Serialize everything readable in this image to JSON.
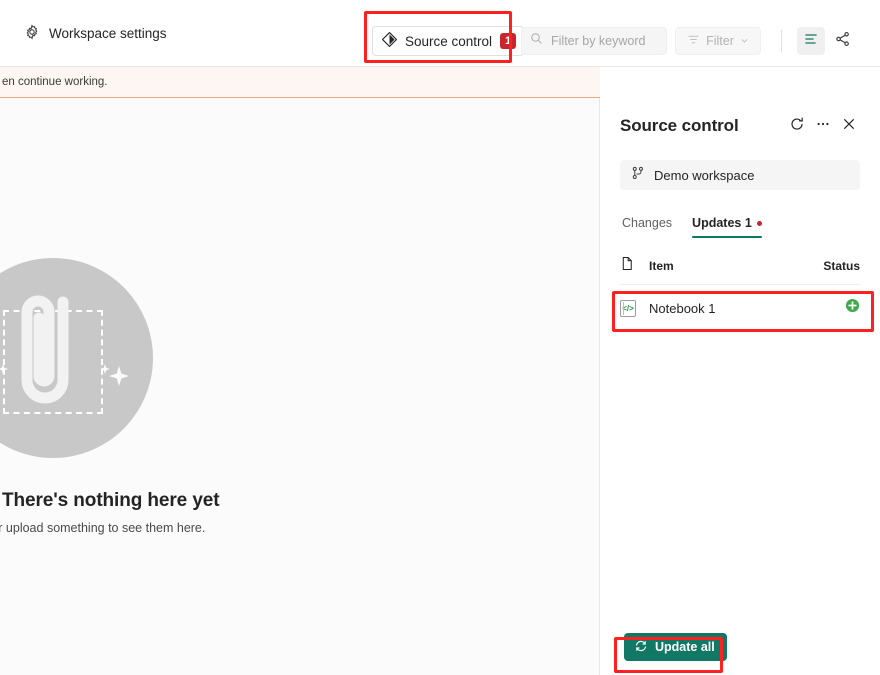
{
  "toolbar": {
    "workspace_settings_label": "Workspace settings",
    "workspace_settings_icon": "gear-icon",
    "source_control_label": "Source control",
    "source_control_icon": "source-control-icon",
    "source_control_badge": "1",
    "search_placeholder": "Filter by keyword",
    "search_value": "",
    "search_icon": "search-icon",
    "filter_label": "Filter",
    "filter_icon": "filter-icon",
    "filter_chevron_icon": "chevron-down-icon",
    "view_list_icon": "list-view-icon",
    "lineage_icon": "lineage-share-icon"
  },
  "notification": {
    "text": "en continue working."
  },
  "empty_state": {
    "illustration_icon": "paperclip-illustration",
    "title": "There's nothing here yet",
    "subtitle": "ing new, or upload something to see them here."
  },
  "panel": {
    "title": "Source control",
    "refresh_icon": "refresh-icon",
    "more_icon": "ellipsis-icon",
    "close_icon": "close-icon",
    "branch": {
      "name": "Demo workspace",
      "icon": "git-branch-icon"
    },
    "tabs": [
      {
        "label": "Changes",
        "active": false
      },
      {
        "label": "Updates 1",
        "active": true,
        "dot": true
      }
    ],
    "table": {
      "header_icon": "document-icon",
      "col_item": "Item",
      "col_status": "Status",
      "rows": [
        {
          "name": "Notebook 1",
          "icon": "notebook-icon",
          "status": "added",
          "status_icon": "plus-circle-icon"
        }
      ]
    },
    "footer": {
      "update_all_label": "Update all",
      "update_all_icon": "refresh-icon"
    }
  },
  "colors": {
    "accent_teal": "#117865",
    "badge_red": "#c5272d",
    "status_green": "#3faa4a",
    "annotation_red": "#ff2020",
    "notification_bg": "#fdf6f3",
    "notification_border": "#e9a97f"
  },
  "annotations": [
    {
      "name": "source-control-button-highlight"
    },
    {
      "name": "notebook-row-highlight"
    },
    {
      "name": "update-all-button-highlight"
    }
  ]
}
